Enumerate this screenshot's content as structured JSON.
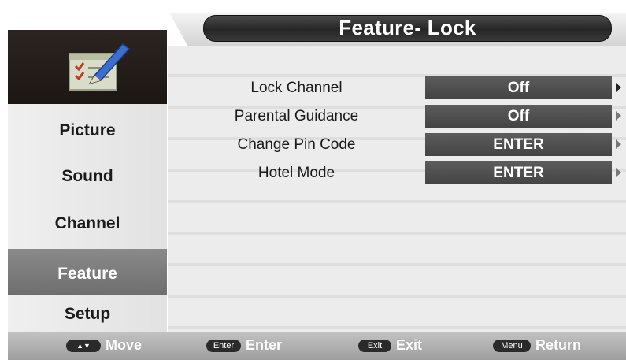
{
  "menu": {
    "title": "Feature- Lock",
    "sidebar": [
      {
        "label": "Picture"
      },
      {
        "label": "Sound"
      },
      {
        "label": "Channel"
      },
      {
        "label": "Feature",
        "active": true
      },
      {
        "label": "Setup"
      }
    ],
    "icon": "checklist-pencil-icon"
  },
  "rows": [
    {
      "label": "Lock Channel",
      "value": "Off"
    },
    {
      "label": "Parental Guidance",
      "value": "Off"
    },
    {
      "label": "Change Pin Code",
      "value": "ENTER"
    },
    {
      "label": "Hotel Mode",
      "value": "ENTER"
    }
  ],
  "footer": {
    "hints": [
      {
        "key": "▲▼",
        "label": "Move"
      },
      {
        "key": "Enter",
        "label": "Enter"
      },
      {
        "key": "Exit",
        "label": "Exit"
      },
      {
        "key": "Menu",
        "label": "Return"
      }
    ]
  },
  "colors": {
    "title_bg": "#2b2b2b",
    "value_bg": "#4e4e4e",
    "active_item_bg": "#7d7d7d",
    "footer_bg": "#b0b0b0"
  }
}
